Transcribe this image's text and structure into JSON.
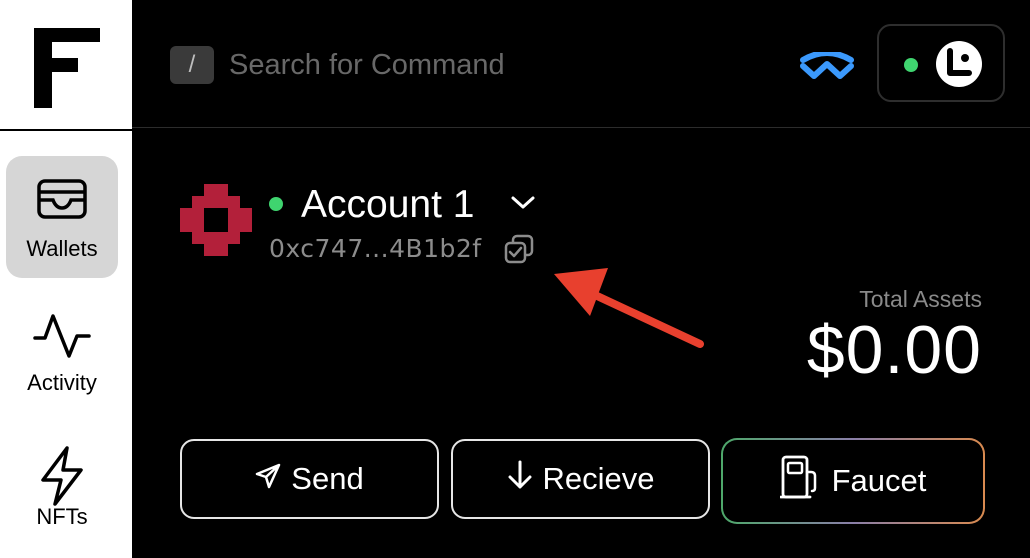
{
  "sidebar": {
    "logo": "F",
    "items": [
      {
        "label": "Wallets",
        "icon": "wallet-icon",
        "active": true
      },
      {
        "label": "Activity",
        "icon": "activity-icon",
        "active": false
      },
      {
        "label": "NFTs",
        "icon": "lightning-icon",
        "active": false
      }
    ]
  },
  "header": {
    "shortcut_key": "/",
    "search_placeholder": "Search for Command",
    "walletconnect_icon": "walletconnect-icon",
    "connection_status_color": "#3fd46f"
  },
  "account": {
    "name": "Account 1",
    "address": "0xc747...4B1b2f",
    "status_color": "#3fd46f",
    "identicon_color": "#b3203a"
  },
  "assets": {
    "label": "Total Assets",
    "value": "$0.00"
  },
  "actions": {
    "send": "Send",
    "receive": "Recieve",
    "faucet": "Faucet"
  },
  "annotation": {
    "arrow_color": "#e8402e"
  }
}
